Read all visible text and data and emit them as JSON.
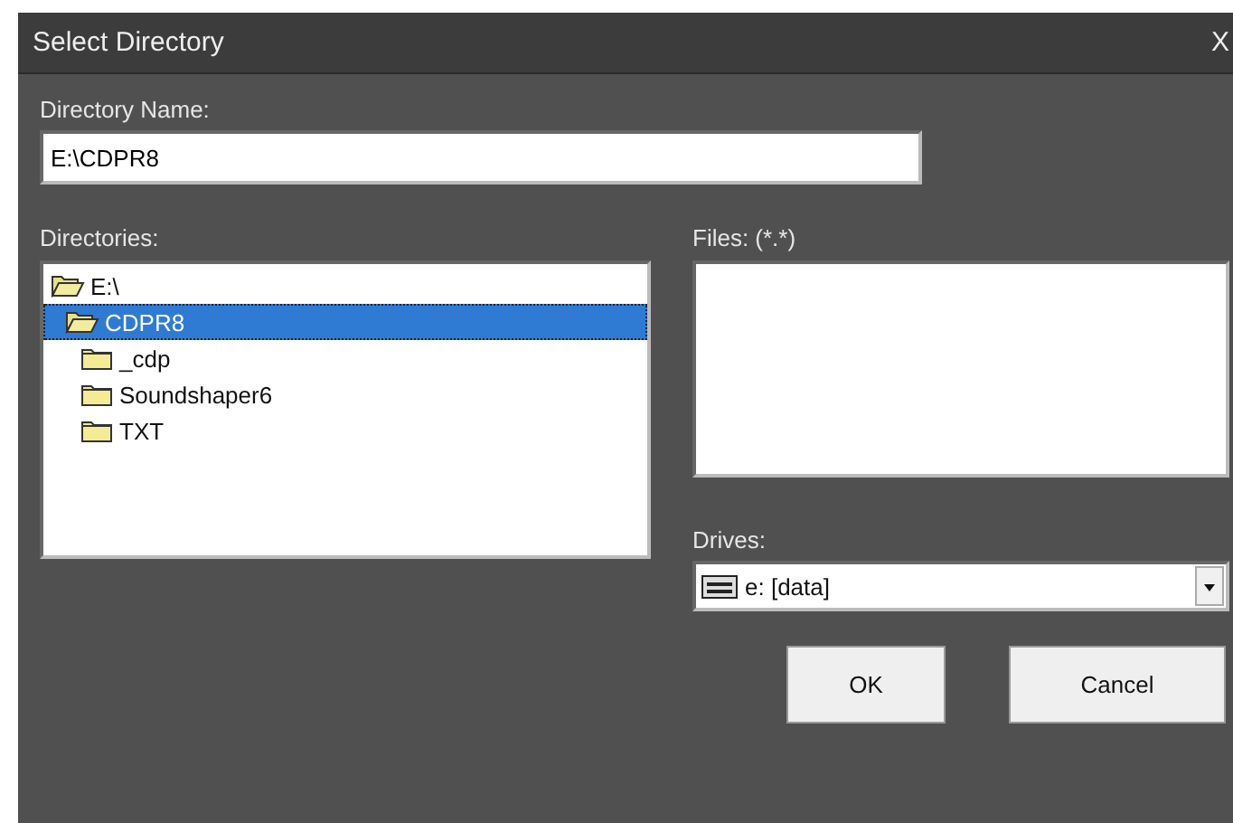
{
  "window": {
    "title": "Select Directory",
    "close": "X"
  },
  "directory_name": {
    "label": "Directory Name:",
    "value": "E:\\CDPR8"
  },
  "directories": {
    "label": "Directories:",
    "tree": [
      {
        "name": "E:\\",
        "expanded": true,
        "selected": false,
        "children": [
          {
            "name": "CDPR8",
            "expanded": true,
            "selected": true,
            "children": [
              {
                "name": "_cdp",
                "expanded": false,
                "selected": false
              },
              {
                "name": "Soundshaper6",
                "expanded": false,
                "selected": false
              },
              {
                "name": "TXT",
                "expanded": false,
                "selected": false
              }
            ]
          }
        ]
      }
    ]
  },
  "files": {
    "label": "Files: (*.*)"
  },
  "drives": {
    "label": "Drives:",
    "value": "e: [data]"
  },
  "buttons": [
    "OK",
    "Cancel"
  ]
}
